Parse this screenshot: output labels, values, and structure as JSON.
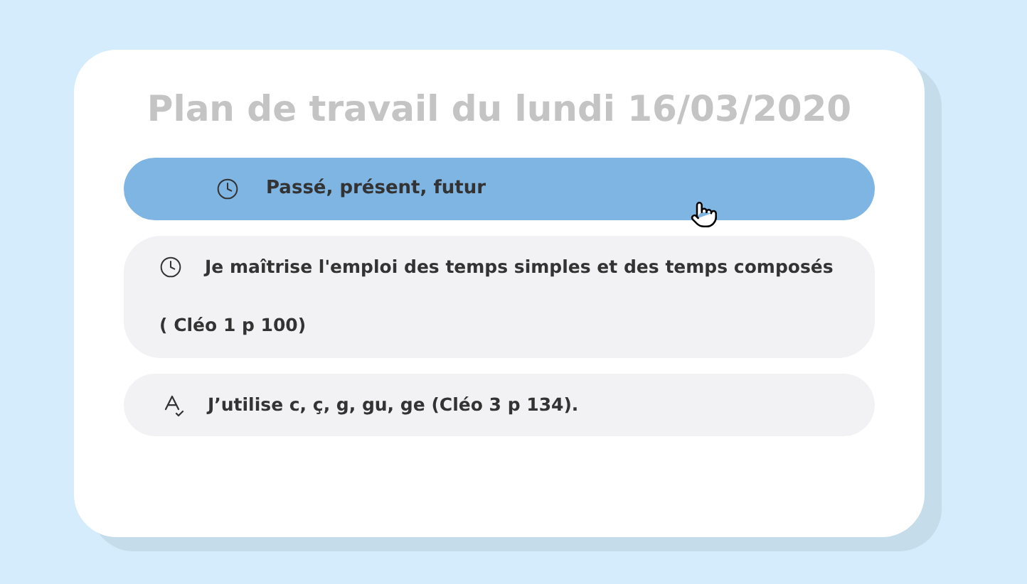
{
  "title": "Plan de travail du lundi 16/03/2020",
  "items": [
    {
      "kind": "heading",
      "selected": true,
      "lines": [
        "Passé, présent, futur"
      ]
    },
    {
      "kind": "timed",
      "selected": false,
      "lines": [
        "Je maîtrise l'emploi des temps simples et des temps composés",
        "( Cléo 1 p 100)"
      ]
    },
    {
      "kind": "spelling",
      "selected": false,
      "lines": [
        "J’utilise c, ç, g, gu, ge (Cléo 3 p 134)."
      ]
    }
  ]
}
